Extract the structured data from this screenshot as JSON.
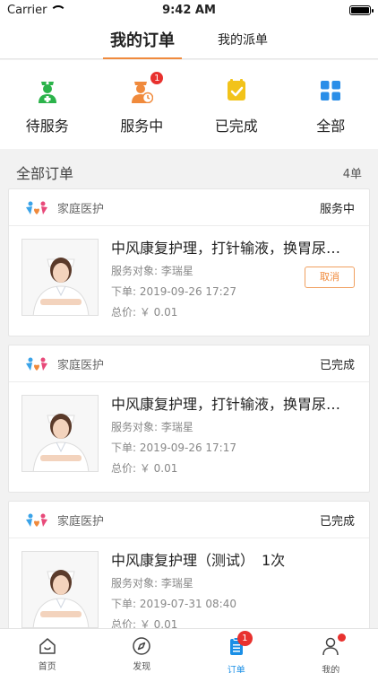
{
  "status_bar": {
    "carrier": "Carrier",
    "time": "9:42 AM"
  },
  "top_tabs": [
    {
      "label": "我的订单",
      "active": true
    },
    {
      "label": "我的派单",
      "active": false
    }
  ],
  "status_filters": [
    {
      "label": "待服务",
      "icon": "nurse-icon",
      "color": "#2bb34a"
    },
    {
      "label": "服务中",
      "icon": "nurse-clock-icon",
      "color": "#f08a3c",
      "badge": "1"
    },
    {
      "label": "已完成",
      "icon": "checked-box-icon",
      "color": "#f2c31a"
    },
    {
      "label": "全部",
      "icon": "grid-icon",
      "color": "#2a8ee8"
    }
  ],
  "section": {
    "title": "全部订单",
    "count": "4单"
  },
  "orders": [
    {
      "source": "家庭医护",
      "status": "服务中",
      "title": "中风康复护理，打针输液，换胃尿…",
      "target": "服务对象: 李瑞星",
      "ordered": "下单: 2019-09-26 17:27",
      "price": "总价: ￥ 0.01",
      "action": "取消"
    },
    {
      "source": "家庭医护",
      "status": "已完成",
      "title": "中风康复护理，打针输液，换胃尿…",
      "target": "服务对象: 李瑞星",
      "ordered": "下单: 2019-09-26 17:17",
      "price": "总价: ￥ 0.01"
    },
    {
      "source": "家庭医护",
      "status": "已完成",
      "title": "中风康复护理（测试）　1次",
      "target": "服务对象: 李瑞星",
      "ordered": "下单: 2019-07-31 08:40",
      "price": "总价: ￥ 0.01"
    }
  ],
  "tab_bar": [
    {
      "label": "首页",
      "icon": "home-icon",
      "active": false
    },
    {
      "label": "发现",
      "icon": "compass-icon",
      "active": false
    },
    {
      "label": "订单",
      "icon": "clipboard-icon",
      "active": true,
      "badge": "1"
    },
    {
      "label": "我的",
      "icon": "person-icon",
      "active": false,
      "dot": true
    }
  ],
  "colors": {
    "accent": "#f08a3c",
    "active_tab": "#1a8fe6",
    "badge": "#e8312e"
  }
}
